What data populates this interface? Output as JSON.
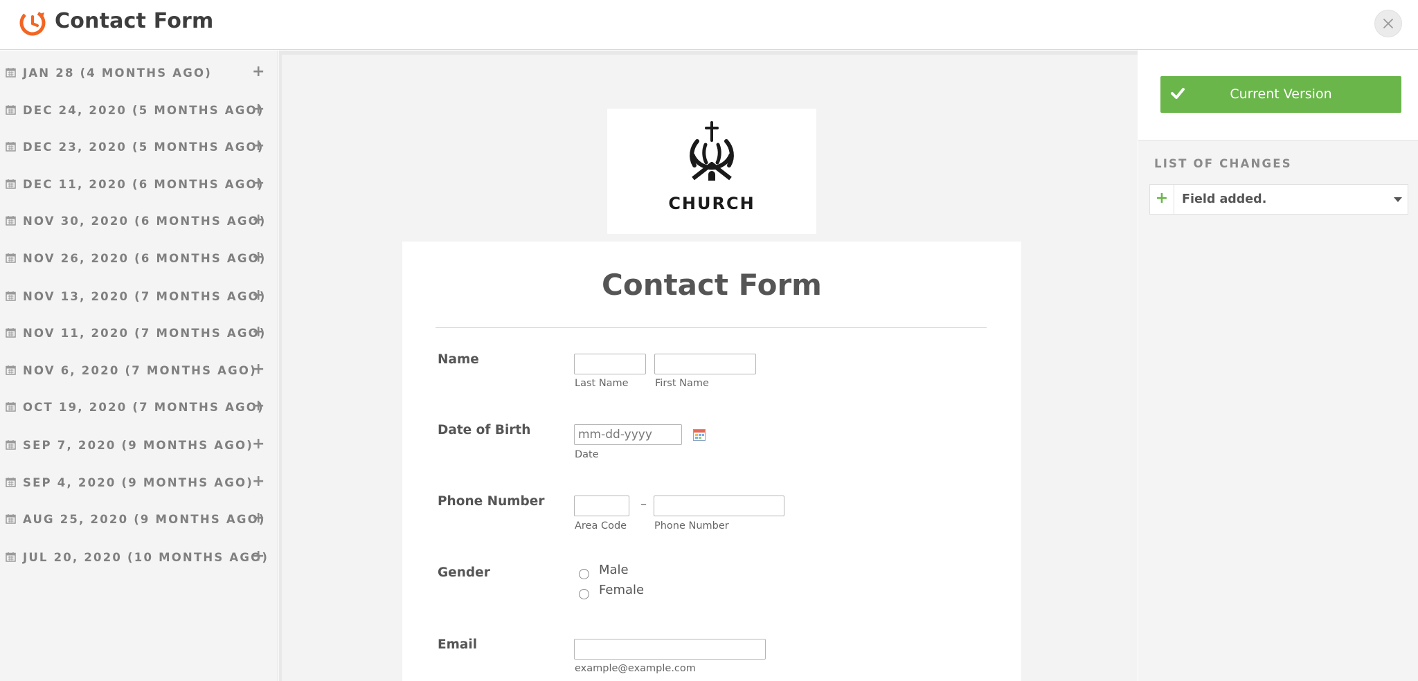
{
  "header": {
    "title": "Contact Form"
  },
  "sidebar": {
    "revisions": [
      {
        "label": "JAN 28 (4 MONTHS AGO)"
      },
      {
        "label": "DEC 24, 2020 (5 MONTHS AGO)"
      },
      {
        "label": "DEC 23, 2020 (5 MONTHS AGO)"
      },
      {
        "label": "DEC 11, 2020 (6 MONTHS AGO)"
      },
      {
        "label": "NOV 30, 2020 (6 MONTHS AGO)"
      },
      {
        "label": "NOV 26, 2020 (6 MONTHS AGO)"
      },
      {
        "label": "NOV 13, 2020 (7 MONTHS AGO)"
      },
      {
        "label": "NOV 11, 2020 (7 MONTHS AGO)"
      },
      {
        "label": "NOV 6, 2020 (7 MONTHS AGO)"
      },
      {
        "label": "OCT 19, 2020 (7 MONTHS AGO)"
      },
      {
        "label": "SEP 7, 2020 (9 MONTHS AGO)"
      },
      {
        "label": "SEP 4, 2020 (9 MONTHS AGO)"
      },
      {
        "label": "AUG 25, 2020 (9 MONTHS AGO)"
      },
      {
        "label": "JUL 20, 2020 (10 MONTHS AGO)"
      }
    ],
    "expand_glyph": "+",
    "icon": "calendar-icon"
  },
  "preview": {
    "logo_text": "CHURCH",
    "form_title": "Contact Form",
    "fields": {
      "name": {
        "label": "Name",
        "last_sublabel": "Last Name",
        "first_sublabel": "First Name"
      },
      "dob": {
        "label": "Date of Birth",
        "placeholder": "mm-dd-yyyy",
        "sublabel": "Date"
      },
      "phone": {
        "label": "Phone Number",
        "separator": "–",
        "area_sublabel": "Area Code",
        "number_sublabel": "Phone Number"
      },
      "gender": {
        "label": "Gender",
        "options": [
          "Male",
          "Female"
        ]
      },
      "email": {
        "label": "Email",
        "sublabel": "example@example.com"
      }
    }
  },
  "right_panel": {
    "current_version_label": "Current Version",
    "changes_title": "LIST OF CHANGES",
    "changes": [
      {
        "label": "Field added.",
        "glyph": "+"
      }
    ]
  },
  "colors": {
    "accent_green": "#6ab64b",
    "brand_orange": "#f26522"
  }
}
